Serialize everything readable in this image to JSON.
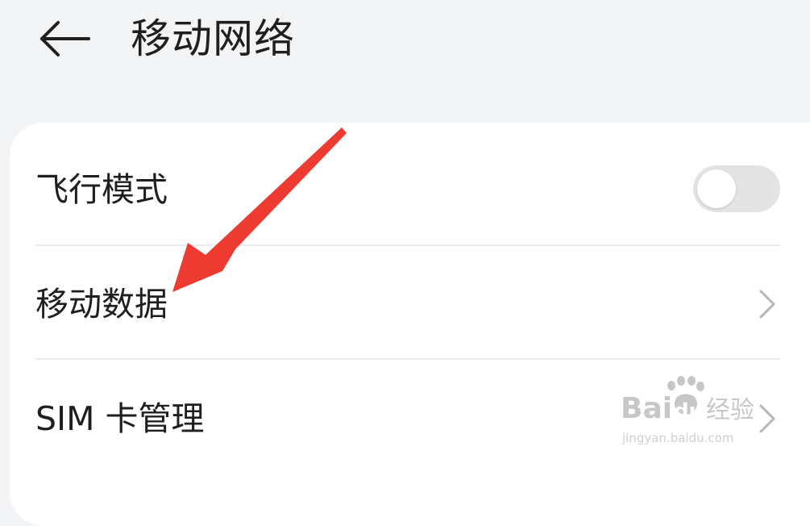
{
  "header": {
    "title": "移动网络",
    "back_icon": "arrow-left-icon"
  },
  "settings": {
    "items": [
      {
        "label": "飞行模式",
        "control": "toggle",
        "toggle_on": false
      },
      {
        "label": "移动数据",
        "control": "chevron",
        "icon": "chevron-right-icon"
      },
      {
        "label": "SIM 卡管理",
        "control": "chevron",
        "icon": "chevron-right-icon"
      }
    ]
  },
  "annotation": {
    "arrow_color": "#ee3b32",
    "arrow_icon": "red-arrow-icon"
  },
  "watermark": {
    "logo_text": "Bai du 经验",
    "url_text": "jingyan.baidu.com"
  },
  "colors": {
    "background": "#f3f4f6",
    "card": "#ffffff",
    "toggle_off": "#e4e4e4",
    "arrow": "#ee3b32"
  }
}
